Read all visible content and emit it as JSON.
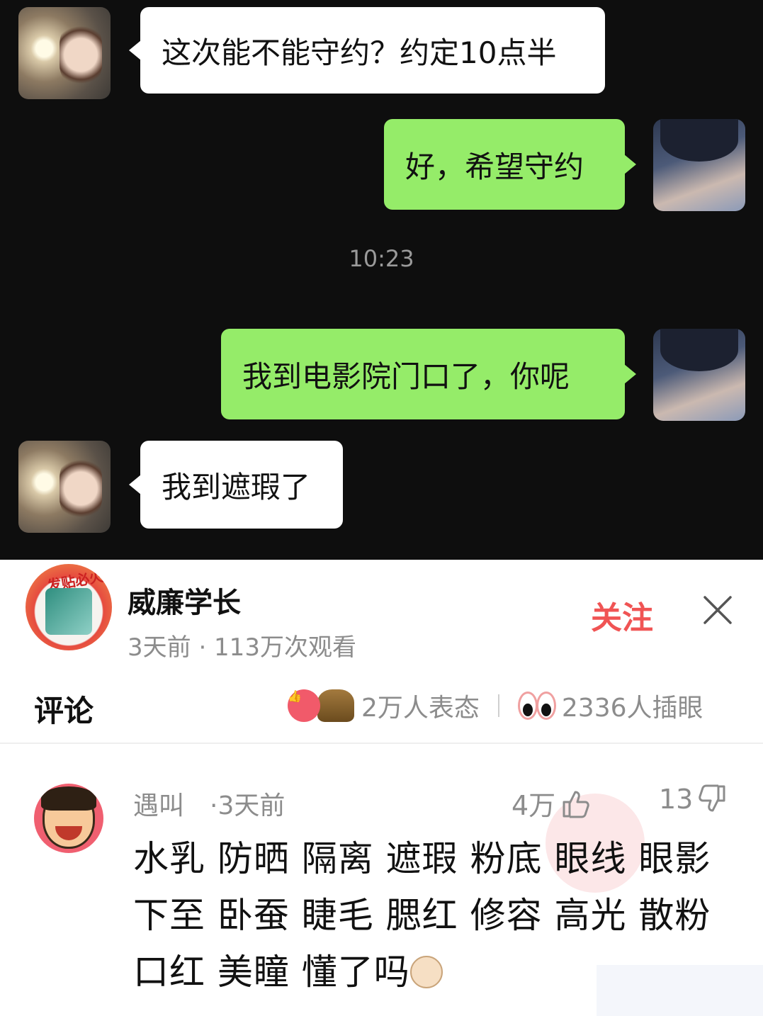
{
  "chat": {
    "messages": [
      {
        "side": "left",
        "text": "这次能不能守约？约定10点半"
      },
      {
        "side": "right",
        "text": "好，希望守约"
      },
      {
        "side": "right",
        "text": "我到电影院门口了，你呢"
      },
      {
        "side": "left",
        "text": "我到遮瑕了"
      }
    ],
    "timestamp": "10:23",
    "bubble_colors": {
      "left": "#ffffff",
      "right": "#95ec69"
    },
    "background": "#0e0e0e"
  },
  "post": {
    "author_name": "威廉学长",
    "author_badge": "发贴必火",
    "meta": "3天前 · 113万次观看",
    "follow_label": "关注"
  },
  "comments_header": {
    "title": "评论",
    "reactions_count": "2万人表态",
    "eyes_count": "2336人插眼"
  },
  "comment": {
    "user": "遇叫",
    "time": "·3天前",
    "likes": "4万",
    "dislikes": "13",
    "text": "水乳 防晒 隔离 遮瑕 粉底 眼线 眼影 下至 卧蚕 睫毛 腮红 修容 高光 散粉 口红 美瞳 懂了吗"
  },
  "colors": {
    "accent": "#f05454",
    "muted": "#8c8c8c"
  }
}
